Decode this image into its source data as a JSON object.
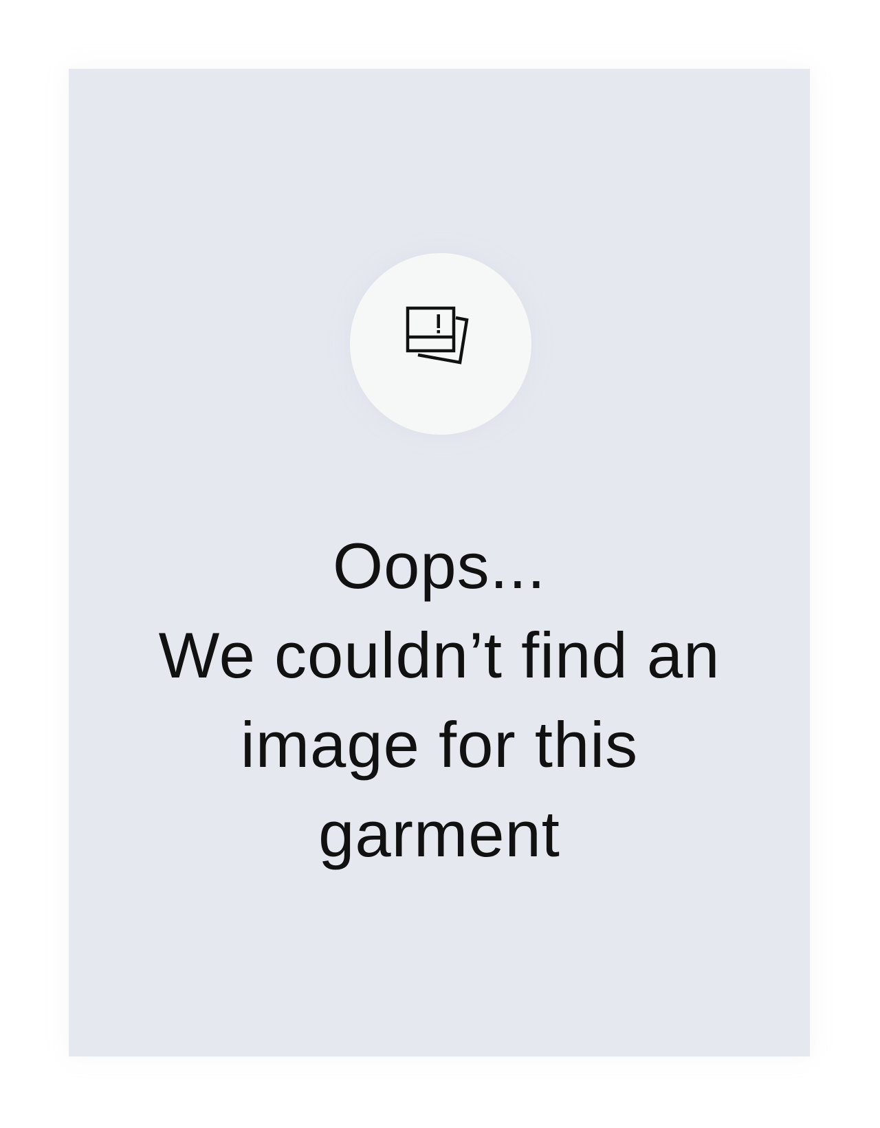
{
  "placeholder": {
    "icon": "missing-image-icon",
    "heading": "Oops...",
    "message": "We couldn’t find an image for this garment",
    "colors": {
      "card_background": "#e6e8f0",
      "icon_circle_background": "#f6f7f7",
      "text": "#111111"
    }
  }
}
